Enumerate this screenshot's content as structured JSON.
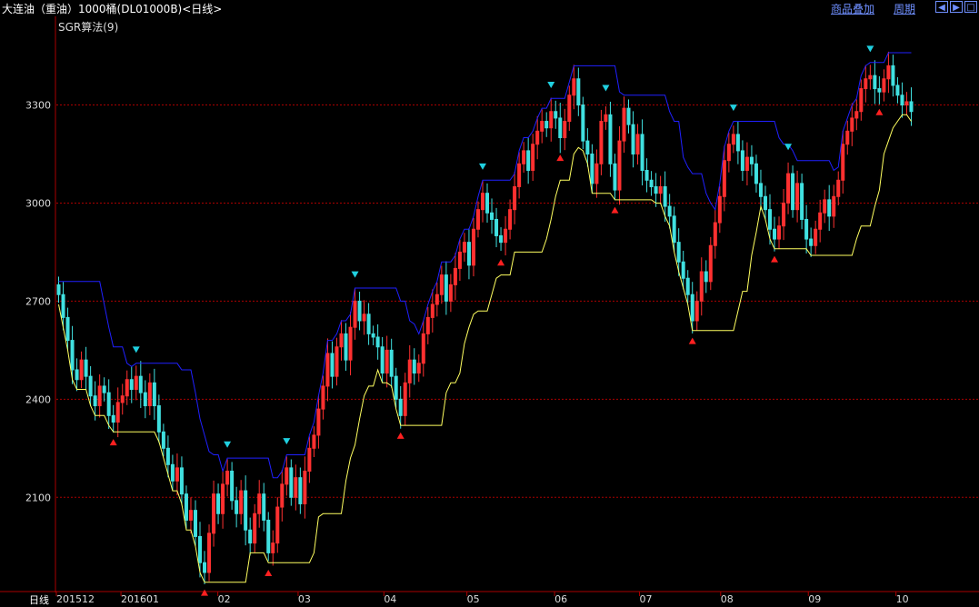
{
  "header": {
    "title": "大连油（重油）1000桶(DL01000B)<日线>",
    "menu_overlay": "商品叠加",
    "menu_period": "周期",
    "nav_icons": [
      "arrow-left-icon",
      "arrow-right-icon",
      "window-icon"
    ]
  },
  "indicator_label": "SGR算法(9)",
  "period_label": "日线",
  "chart_data": {
    "type": "candlestick",
    "yticks": [
      2100,
      2400,
      2700,
      3000,
      3300
    ],
    "ylim": [
      1820,
      3560
    ],
    "xticks": [
      "201512",
      "201601",
      "02",
      "03",
      "04",
      "05",
      "06",
      "07",
      "08",
      "09",
      "10"
    ],
    "grid": true,
    "colors": {
      "up": "#ff3030",
      "down": "#40e0e0",
      "support": "#ffff60",
      "resistance": "#2020ff",
      "buy_marker": "#ff2020",
      "sell_marker": "#20d0e0",
      "grid": "#aa0000"
    },
    "closes": [
      2720,
      2650,
      2580,
      2490,
      2460,
      2520,
      2470,
      2410,
      2380,
      2440,
      2420,
      2350,
      2330,
      2390,
      2410,
      2460,
      2430,
      2470,
      2420,
      2380,
      2450,
      2380,
      2300,
      2250,
      2200,
      2150,
      2190,
      2110,
      2030,
      2060,
      1980,
      1900,
      1870,
      1990,
      2110,
      2050,
      2140,
      2180,
      2090,
      2050,
      2120,
      2000,
      1960,
      2050,
      2110,
      2030,
      1930,
      1960,
      2070,
      2140,
      2190,
      2100,
      2160,
      2080,
      2180,
      2250,
      2290,
      2370,
      2440,
      2540,
      2470,
      2560,
      2600,
      2520,
      2620,
      2700,
      2640,
      2660,
      2600,
      2590,
      2560,
      2480,
      2550,
      2470,
      2400,
      2350,
      2450,
      2520,
      2480,
      2510,
      2600,
      2650,
      2690,
      2720,
      2780,
      2700,
      2750,
      2800,
      2850,
      2880,
      2810,
      2920,
      2980,
      3030,
      2970,
      2950,
      2900,
      2880,
      2920,
      2980,
      3050,
      3120,
      3160,
      3100,
      3180,
      3220,
      3250,
      3230,
      3280,
      3260,
      3200,
      3250,
      3330,
      3380,
      3300,
      3190,
      3150,
      3060,
      3120,
      3250,
      3270,
      3120,
      3040,
      3190,
      3290,
      3240,
      3150,
      3210,
      3100,
      3070,
      3050,
      3030,
      3050,
      2990,
      2960,
      2880,
      2820,
      2770,
      2720,
      2640,
      2700,
      2790,
      2760,
      2870,
      2940,
      3020,
      3130,
      3180,
      3210,
      3160,
      3100,
      3140,
      3120,
      3060,
      3020,
      2980,
      2920,
      2890,
      2930,
      3000,
      3090,
      2980,
      3060,
      2950,
      2890,
      2870,
      2920,
      2970,
      3010,
      2960,
      3020,
      3070,
      3180,
      3220,
      3260,
      3280,
      3350,
      3380,
      3390,
      3350,
      3340,
      3380,
      3420,
      3360,
      3330,
      3300,
      3310,
      3280
    ]
  }
}
